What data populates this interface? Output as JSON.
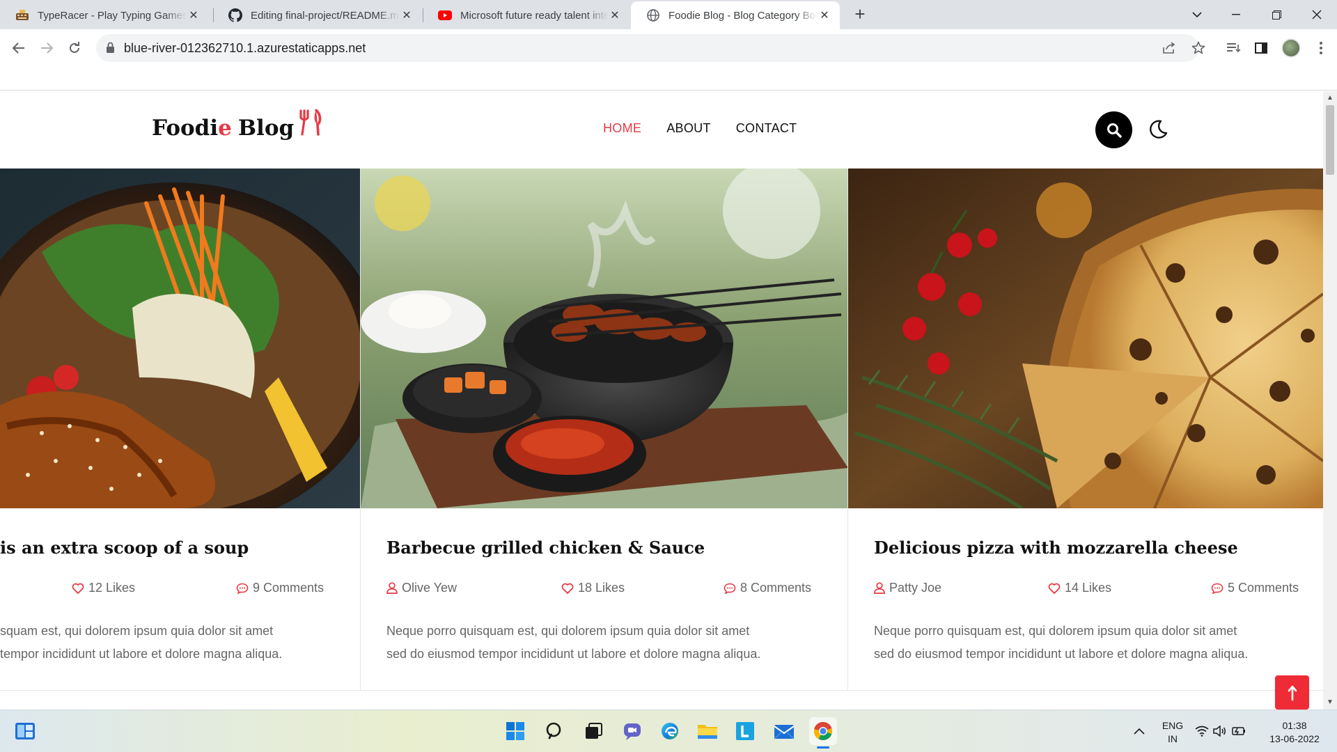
{
  "browser": {
    "tabs": [
      {
        "title": "TypeRacer - Play Typing Games and",
        "icon": "typeracer-favicon",
        "active": false
      },
      {
        "title": "Editing final-project/README.md",
        "icon": "github-favicon",
        "active": false
      },
      {
        "title": "Microsoft future ready talent inte",
        "icon": "youtube-favicon",
        "active": false
      },
      {
        "title": "Foodie Blog - Blog Category Book",
        "icon": "globe-favicon",
        "active": true
      }
    ],
    "url": "blue-river-012362710.1.azurestaticapps.net"
  },
  "site": {
    "logo_part1": "Foodi",
    "logo_accent": "e",
    "logo_part2": "Blog",
    "accent_color": "#e63946",
    "nav": [
      {
        "label": "HOME",
        "active": true
      },
      {
        "label": "ABOUT",
        "active": false
      },
      {
        "label": "CONTACT",
        "active": false
      }
    ]
  },
  "posts": [
    {
      "title": "is an extra scoop of a soup",
      "author": "",
      "likes": "12 Likes",
      "comments": "9 Comments",
      "excerpt_line1": "squam est, qui dolorem ipsum quia dolor sit amet",
      "excerpt_line2": " tempor incididunt ut labore et dolore magna aliqua.",
      "image": "grilled-chicken-salad-bowl"
    },
    {
      "title": "Barbecue grilled chicken & Sauce",
      "author": "Olive Yew",
      "likes": "18 Likes",
      "comments": "8 Comments",
      "excerpt_line1": "Neque porro quisquam est, qui dolorem ipsum quia dolor sit amet",
      "excerpt_line2": "sed do eiusmod tempor incididunt ut labore et dolore magna aliqua.",
      "image": "barbecue-skewers-grill"
    },
    {
      "title": "Delicious pizza with mozzarella cheese",
      "author": "Patty Joe",
      "likes": "14 Likes",
      "comments": "5 Comments",
      "excerpt_line1": "Neque porro quisquam est, qui dolorem ipsum quia dolor sit amet",
      "excerpt_line2": "sed do eiusmod tempor incididunt ut labore et dolore magna aliqua.",
      "image": "pizza-mozzarella"
    }
  ],
  "taskbar": {
    "lang_line1": "ENG",
    "lang_line2": "IN",
    "time": "01:38",
    "date": "13-06-2022"
  }
}
